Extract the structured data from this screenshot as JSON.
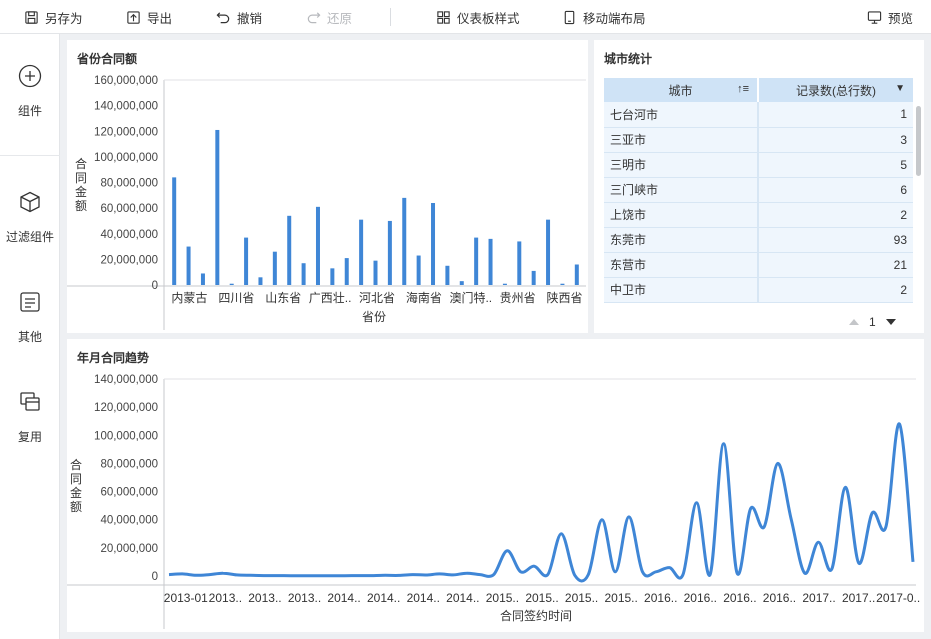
{
  "toolbar": {
    "save_as": "另存为",
    "export": "导出",
    "undo": "撤销",
    "redo": "还原",
    "dashboard_style": "仪表板样式",
    "mobile_layout": "移动端布局",
    "preview": "预览"
  },
  "sidebar": {
    "components": "组件",
    "filter_components": "过滤组件",
    "other": "其他",
    "reuse": "复用"
  },
  "colors": {
    "accent": "#3f86d6",
    "header_bg": "#cfe3f6",
    "row_bg": "#eff6fd"
  },
  "bar_panel": {
    "title": "省份合同额"
  },
  "table_panel": {
    "title": "城市统计",
    "col_city": "城市",
    "col_count": "记录数(总行数)",
    "rows": [
      {
        "city": "七台河市",
        "count": "1"
      },
      {
        "city": "三亚市",
        "count": "3"
      },
      {
        "city": "三明市",
        "count": "5"
      },
      {
        "city": "三门峡市",
        "count": "6"
      },
      {
        "city": "上饶市",
        "count": "2"
      },
      {
        "city": "东莞市",
        "count": "93"
      },
      {
        "city": "东营市",
        "count": "21"
      },
      {
        "city": "中卫市",
        "count": "2"
      }
    ],
    "page": "1"
  },
  "line_panel": {
    "title": "年月合同趋势"
  },
  "chart_data": [
    {
      "type": "bar",
      "xlabel": "省份",
      "ylabel": "合同金额",
      "ylim": [
        0,
        160000000
      ],
      "yticks": [
        0,
        20000000,
        40000000,
        60000000,
        80000000,
        100000000,
        120000000,
        140000000,
        160000000
      ],
      "ytick_labels": [
        "0",
        "20,000,000",
        "40,000,000",
        "60,000,000",
        "80,000,000",
        "100,000,000",
        "120,000,000",
        "140,000,000",
        "160,000,000"
      ],
      "category_labels_shown": [
        "内蒙古",
        "四川省",
        "山东省",
        "广西壮..",
        "河北省",
        "海南省",
        "澳门特..",
        "贵州省",
        "陕西省"
      ],
      "values": [
        84000000,
        30000000,
        9000000,
        121000000,
        1000000,
        37000000,
        6000000,
        26000000,
        54000000,
        17000000,
        61000000,
        13000000,
        21000000,
        51000000,
        19000000,
        50000000,
        68000000,
        23000000,
        64000000,
        15000000,
        3000000,
        37000000,
        36000000,
        1000000,
        34000000,
        11000000,
        51000000,
        1000000,
        16000000
      ],
      "grid": false
    },
    {
      "type": "line",
      "xlabel": "合同签约时间",
      "ylabel": "合同金额",
      "ylim": [
        0,
        140000000
      ],
      "yticks": [
        0,
        20000000,
        40000000,
        60000000,
        80000000,
        100000000,
        120000000,
        140000000
      ],
      "ytick_labels": [
        "0",
        "20,000,000",
        "40,000,000",
        "60,000,000",
        "80,000,000",
        "100,000,000",
        "120,000,000",
        "140,000,000"
      ],
      "x_labels_shown": [
        "2013-01",
        "2013..",
        "2013..",
        "2013..",
        "2014..",
        "2014..",
        "2014..",
        "2014..",
        "2015..",
        "2015..",
        "2015..",
        "2015..",
        "2016..",
        "2016..",
        "2016..",
        "2016..",
        "2017..",
        "2017..",
        "2017-0.."
      ],
      "values": [
        1000000,
        1500000,
        500000,
        1000000,
        2000000,
        800000,
        500000,
        300000,
        300000,
        200000,
        200000,
        200000,
        200000,
        200000,
        300000,
        300000,
        500000,
        400000,
        1000000,
        700000,
        1500000,
        800000,
        2000000,
        1000000,
        1000000,
        18000000,
        3000000,
        7000000,
        1000000,
        30000000,
        500000,
        1000000,
        40000000,
        3000000,
        42000000,
        3000000,
        3000000,
        6000000,
        1000000,
        52000000,
        1000000,
        94000000,
        2000000,
        48000000,
        35000000,
        80000000,
        40000000,
        2000000,
        24000000,
        5000000,
        63000000,
        9000000,
        45000000,
        35000000,
        108000000,
        10000000
      ],
      "grid": false
    }
  ]
}
